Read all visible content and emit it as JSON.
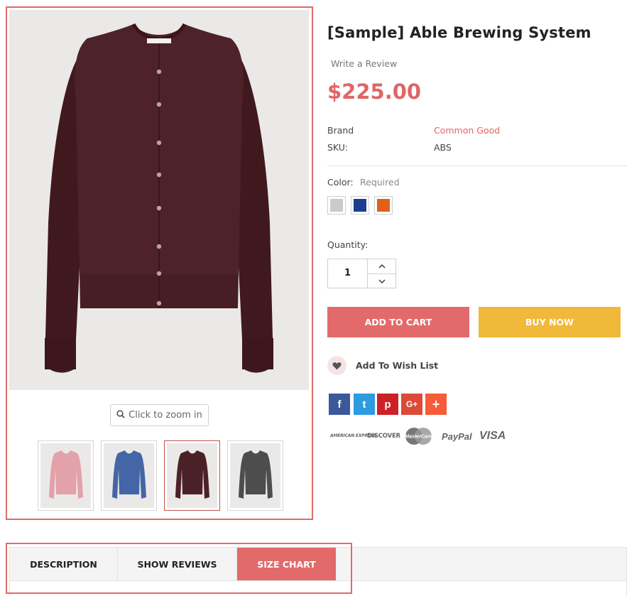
{
  "product": {
    "title": "[Sample] Able Brewing System",
    "review_link": "Write a Review",
    "price": "$225.00",
    "brand_label": "Brand",
    "brand_value": "Common Good",
    "sku_label": "SKU:",
    "sku_value": "ABS"
  },
  "gallery": {
    "zoom_label": "Click to zoom in",
    "main_image_color": "#4b2128",
    "thumbnails": [
      {
        "name": "pink cardigan",
        "color": "#e3a1a9",
        "active": false
      },
      {
        "name": "blue cardigan",
        "color": "#4466a6",
        "active": false
      },
      {
        "name": "burgundy cardigan",
        "color": "#4b2128",
        "active": true
      },
      {
        "name": "grey cardigan",
        "color": "#4d4d4d",
        "active": false
      }
    ]
  },
  "options": {
    "color_label": "Color:",
    "color_required": "Required",
    "swatches": [
      "#cbcbcb",
      "#1d3e8f",
      "#e1611b"
    ],
    "quantity_label": "Quantity:",
    "quantity_value": "1"
  },
  "actions": {
    "add_to_cart": "ADD TO CART",
    "buy_now": "BUY NOW",
    "wishlist": "Add To Wish List"
  },
  "share": [
    {
      "name": "facebook",
      "glyph": "f",
      "color": "#3b5998"
    },
    {
      "name": "twitter",
      "glyph": "t",
      "color": "#2c9be0"
    },
    {
      "name": "pinterest",
      "glyph": "p",
      "color": "#cc2127"
    },
    {
      "name": "google-plus",
      "glyph": "G+",
      "color": "#dc4a38"
    },
    {
      "name": "more",
      "glyph": "+",
      "color": "#f65b3a"
    }
  ],
  "payments": {
    "amex": "AMERICAN EXPRESS",
    "discover": "DISCOVER",
    "mastercard": "MasterCard",
    "paypal": "PayPal",
    "visa": "VISA"
  },
  "tabs": {
    "description": "DESCRIPTION",
    "reviews": "SHOW REVIEWS",
    "size_chart": "SIZE CHART",
    "active": "size_chart"
  },
  "colors": {
    "accent": "#e36a6a",
    "buy_now": "#f0b93a",
    "frame_highlight": "#e06b6b"
  }
}
